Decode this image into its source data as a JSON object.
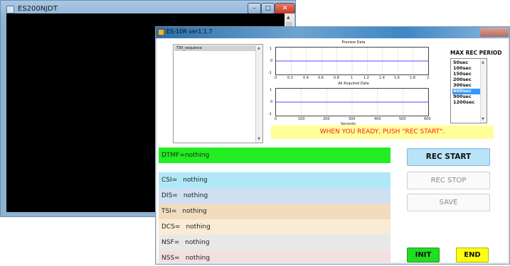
{
  "back_window": {
    "title": "ES200NJDT",
    "minimize": "–",
    "maximize": "□",
    "close": "✕"
  },
  "front_window": {
    "title": "ES-10R  ver1.1.7"
  },
  "sequence_list": {
    "items": [
      "T30_sequence"
    ]
  },
  "preview_plot": {
    "title": "Preview Data",
    "y_ticks": [
      "1",
      "0",
      "-1"
    ],
    "x_ticks": [
      "0",
      "0.2",
      "0.4",
      "0.6",
      "0.8",
      "1",
      "1.2",
      "1.4",
      "1.6",
      "1.8",
      "2"
    ]
  },
  "acquired_plot": {
    "title": "All Acquired Data",
    "y_ticks": [
      "1",
      "0",
      "-1"
    ],
    "x_ticks": [
      "0",
      "100",
      "200",
      "300",
      "400",
      "500",
      "600"
    ],
    "xlabel": "Seconds"
  },
  "period": {
    "title": "MAX REC PERIOD",
    "options": [
      "50sec",
      "100sec",
      "150sec",
      "200sec",
      "300sec",
      "600sec",
      "900sec",
      "1200sec"
    ],
    "selected_index": 5
  },
  "status_message": "WHEN YOU READY, PUSH \"REC START\".",
  "fields": {
    "dtmf": {
      "label": "DTMF=",
      "value": "nothing"
    },
    "csi": {
      "label": "CSI=",
      "value": "nothing"
    },
    "dis": {
      "label": "DIS=",
      "value": "nothing"
    },
    "tsi": {
      "label": "TSI=",
      "value": "nothing"
    },
    "dcs": {
      "label": "DCS=",
      "value": "nothing"
    },
    "nsf": {
      "label": "NSF=",
      "value": "nothing"
    },
    "nss": {
      "label": "NSS=",
      "value": "nothing"
    }
  },
  "buttons": {
    "rec_start": "REC START",
    "rec_stop": "REC STOP",
    "save": "SAVE",
    "init": "INIT",
    "end": "END"
  },
  "colors": {
    "dtmf": "#22ee22",
    "csi": "#b0e8f8",
    "dis": "#cfe0f3",
    "tsi": "#f2dcc0",
    "dcs": "#faebd4",
    "nsf": "#e8e8e8",
    "nss": "#f3dfe0",
    "rec_start": "#b9e4f8",
    "init": "#22dd22",
    "end": "#ffff11",
    "signal": "#4a4aff",
    "status_text": "#ff1a1a"
  }
}
